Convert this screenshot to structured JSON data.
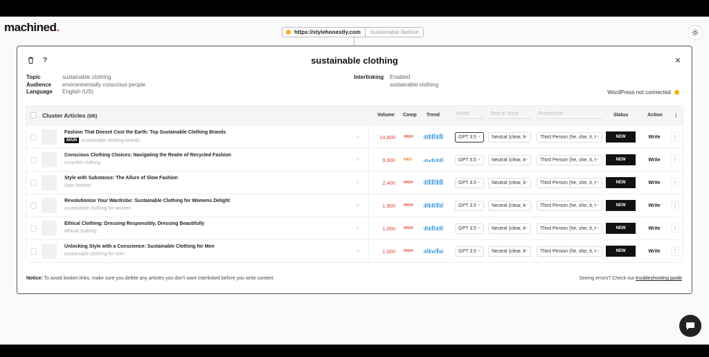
{
  "brand": {
    "name": "machined",
    "dot": "."
  },
  "urlbar": {
    "domain": "https://stylehonestly.com",
    "path": "/sustainable-fashion"
  },
  "settings_icon": "gear-icon",
  "modal": {
    "title": "sustainable clothing",
    "delete_icon": "trash-icon",
    "help_label": "?",
    "close_label": "✕"
  },
  "meta": {
    "topic_label": "Topic",
    "topic": "sustainable clothing",
    "audience_label": "Audience",
    "audience": "environmentally conscious people",
    "language_label": "Language",
    "language": "English (US)",
    "interlinking_label": "Interlinking",
    "interlinking": "Enabled",
    "interlinking_sub": "sustainable clothing",
    "wordpress": "WordPress not connected"
  },
  "table": {
    "title": "Cluster Articles",
    "count": "(0/6)",
    "headers": {
      "volume": "Volume",
      "comp": "Comp",
      "trend": "Trend",
      "model": "Model",
      "tone": "Tone of Voice",
      "perspective": "Perspective",
      "status": "Status",
      "action": "Action",
      "more": "⋮"
    },
    "rows": [
      {
        "title": "Fashion That Doesnt Cost the Earth: Top Sustainable Clothing Brands",
        "badge": "MAIN",
        "keyword": "sustainable clothing brands",
        "volume": "14,800",
        "comp": "HIGH",
        "trend": [
          5,
          6,
          6,
          7,
          6,
          7,
          8,
          7,
          6,
          7,
          8,
          7
        ],
        "model": "GPT 3.5",
        "tone": "Neutral (clear, k",
        "perspective": "Third Person (he, she, it, t",
        "status": "NEW",
        "action": "Write"
      },
      {
        "title": "Conscious Clothing Choices: Navigating the Realm of Recycled Fashion",
        "badge": "",
        "keyword": "recycled clothing",
        "volume": "9,900",
        "comp": "MED",
        "trend": [
          3,
          4,
          4,
          3,
          4,
          5,
          4,
          4,
          5,
          4,
          5,
          6
        ],
        "model": "GPT 3.5",
        "tone": "Neutral (clear, k",
        "perspective": "Third Person (he, she, it, t",
        "status": "NEW",
        "action": "Write"
      },
      {
        "title": "Style with Substance: The Allure of Slow Fashion",
        "badge": "",
        "keyword": "slow fashion",
        "volume": "2,400",
        "comp": "HIGH",
        "trend": [
          6,
          7,
          7,
          8,
          7,
          8,
          7,
          8,
          7,
          7,
          8,
          7
        ],
        "model": "GPT 3.5",
        "tone": "Neutral (clear, k",
        "perspective": "Third Person (he, she, it, t",
        "status": "NEW",
        "action": "Write"
      },
      {
        "title": "Revolutionize Your Wardrobe: Sustainable Clothing for Womens Delight",
        "badge": "",
        "keyword": "sustainable clothing for women",
        "volume": "1,900",
        "comp": "HIGH",
        "trend": [
          5,
          6,
          7,
          6,
          5,
          6,
          7,
          6,
          7,
          6,
          5,
          7
        ],
        "model": "GPT 3.5",
        "tone": "Neutral (clear, k",
        "perspective": "Third Person (he, she, it, t",
        "status": "NEW",
        "action": "Write"
      },
      {
        "title": "Ethical Clothing: Dressing Responsibly, Dressing Beautifully",
        "badge": "",
        "keyword": "ethical clothing",
        "volume": "1,000",
        "comp": "HIGH",
        "trend": [
          5,
          6,
          6,
          5,
          6,
          7,
          6,
          6,
          5,
          6,
          6,
          7
        ],
        "model": "GPT 3.5",
        "tone": "Neutral (clear, k",
        "perspective": "Third Person (he, she, it, t",
        "status": "NEW",
        "action": "Write"
      },
      {
        "title": "Unlocking Style with a Conscience: Sustainable Clothing for Men",
        "badge": "",
        "keyword": "sustainable clothing for men",
        "volume": "1,000",
        "comp": "HIGH",
        "trend": [
          4,
          5,
          7,
          6,
          5,
          4,
          5,
          6,
          7,
          5,
          4,
          6
        ],
        "model": "GPT 3.5",
        "tone": "Neutral (clear, k",
        "perspective": "Third Person (he, she, it, t",
        "status": "NEW",
        "action": "Write"
      }
    ]
  },
  "colors": {
    "high": "#e0452c",
    "med": "#f08a24",
    "trend": "#57a8e0",
    "accent": "#f4b31a"
  },
  "footer": {
    "notice_label": "Notice:",
    "notice_text": " To avoid broken links, make sure you delete any articles you don't want interlinked before you write content.",
    "errors_text": "Seeing errors? Check our ",
    "errors_link": "troubleshooting guide"
  },
  "chat_icon": "chat-bubble-icon"
}
